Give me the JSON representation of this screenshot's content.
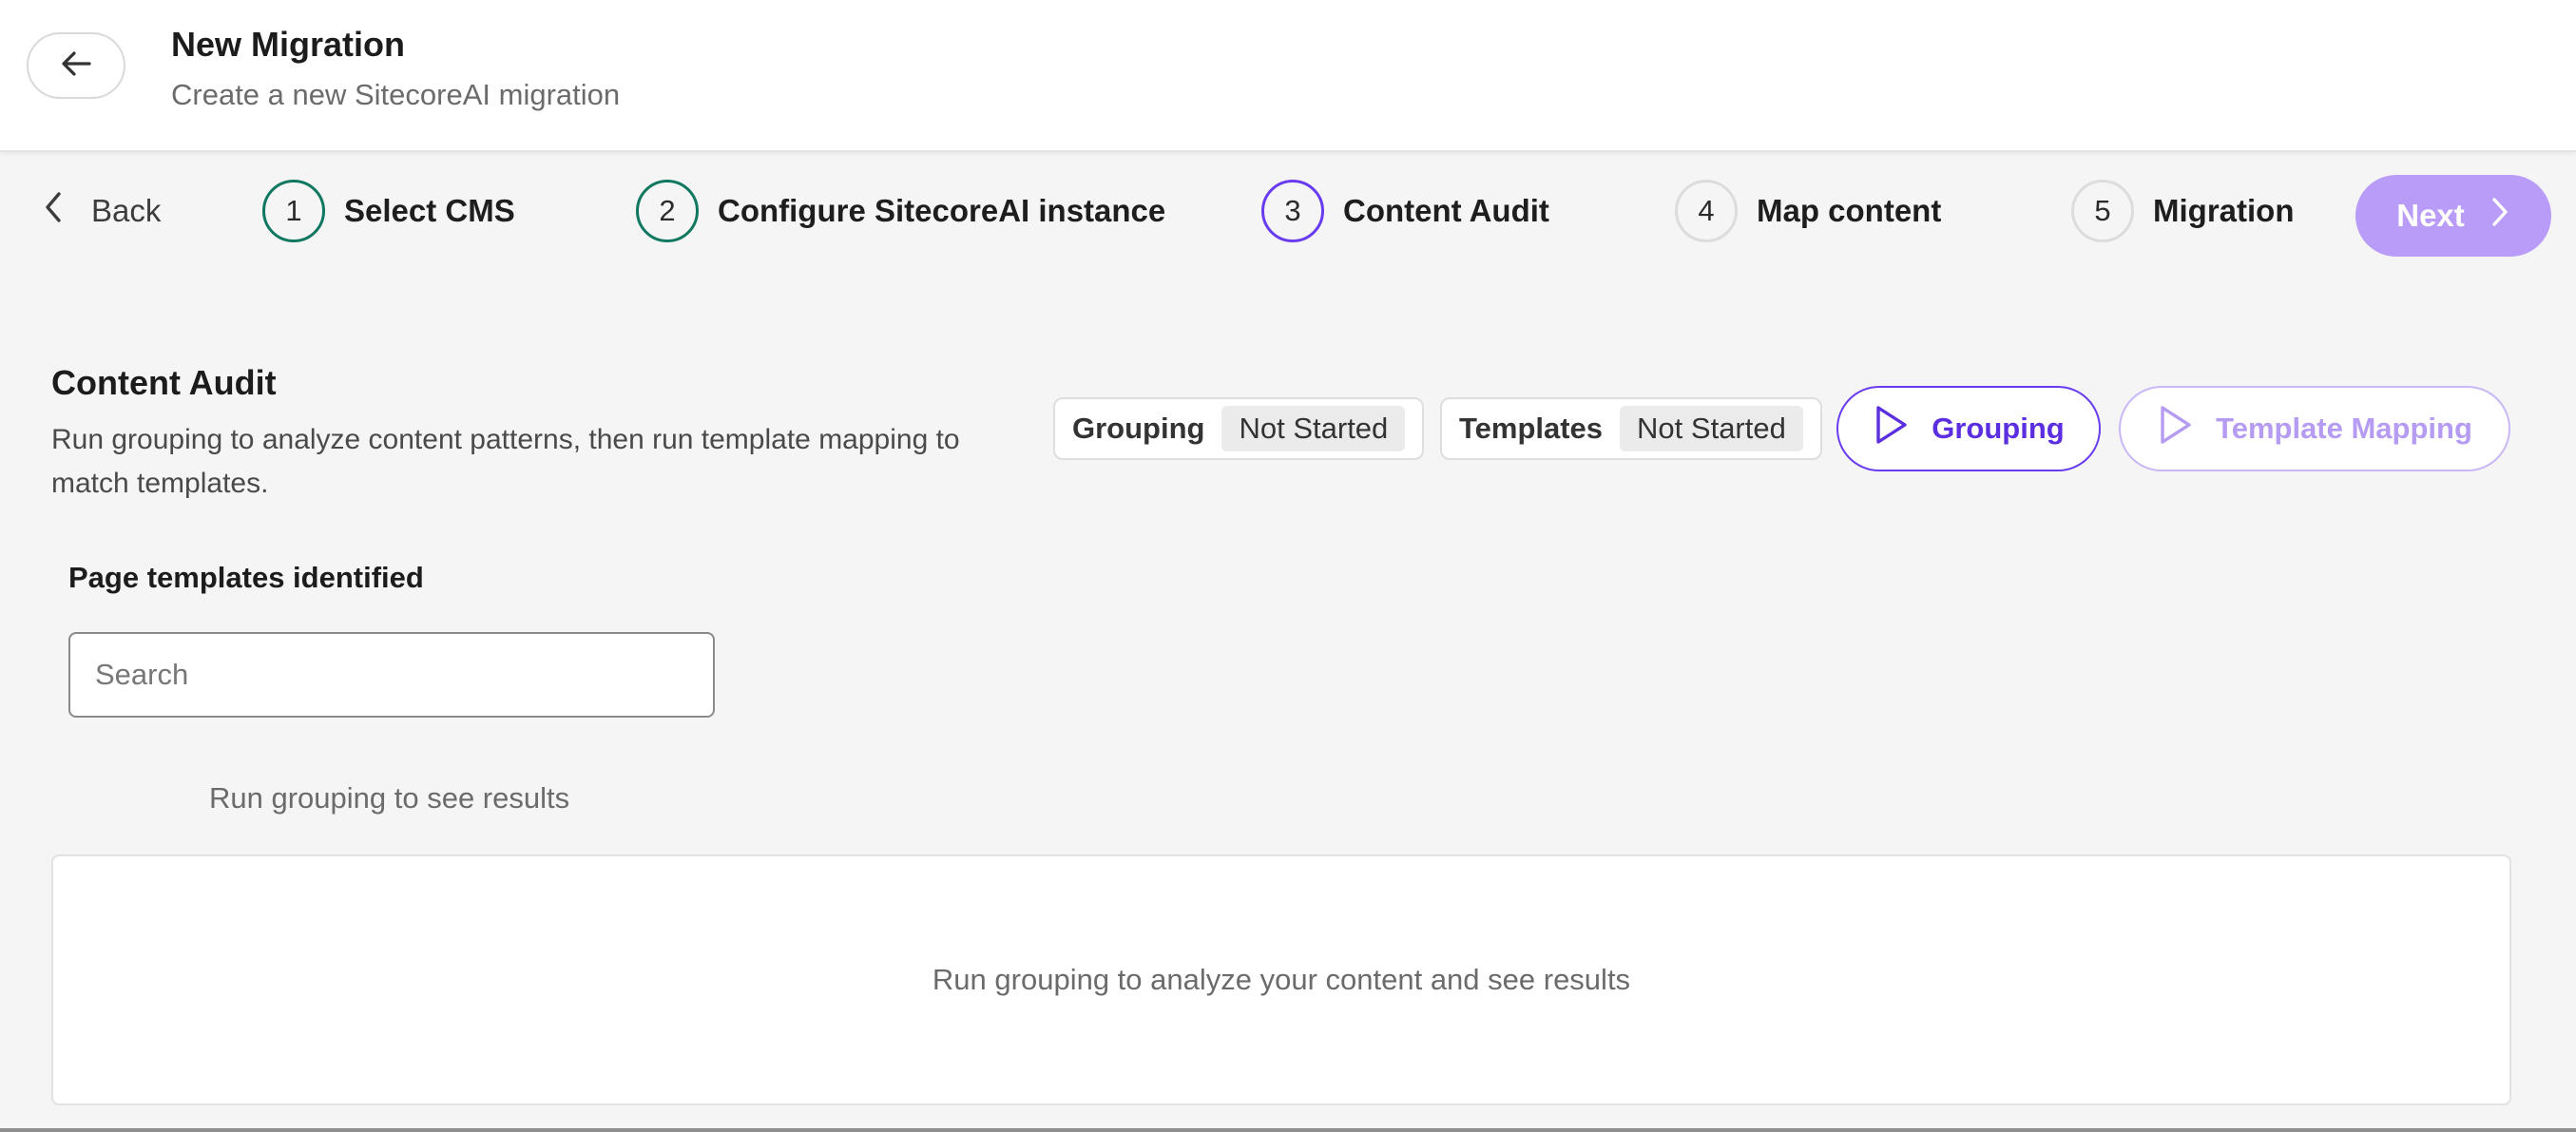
{
  "header": {
    "title": "New Migration",
    "subtitle": "Create a new SitecoreAI migration"
  },
  "stepper": {
    "back_label": "Back",
    "steps": [
      {
        "number": "1",
        "label": "Select CMS",
        "state": "done"
      },
      {
        "number": "2",
        "label": "Configure SitecoreAI instance",
        "state": "done"
      },
      {
        "number": "3",
        "label": "Content Audit",
        "state": "active"
      },
      {
        "number": "4",
        "label": "Map content",
        "state": "todo"
      },
      {
        "number": "5",
        "label": "Migration",
        "state": "todo"
      }
    ],
    "next_label": "Next"
  },
  "audit": {
    "title": "Content Audit",
    "description": "Run grouping to analyze content patterns, then run template mapping to match templates.",
    "statuses": [
      {
        "label": "Grouping",
        "value": "Not Started"
      },
      {
        "label": "Templates",
        "value": "Not Started"
      }
    ],
    "grouping_button": "Grouping",
    "template_mapping_button": "Template Mapping"
  },
  "templates": {
    "heading": "Page templates identified",
    "search_placeholder": "Search",
    "empty_hint": "Run grouping to see results",
    "results_empty_text": "Run grouping to analyze your content and see results"
  },
  "colors": {
    "accent": "#6a3cf0",
    "accent_disabled": "#b99cf7",
    "done": "#107861"
  },
  "icons": {
    "header_back": "arrow-left-icon",
    "step_back": "chevron-left-icon",
    "next": "chevron-right-icon",
    "run": "play-icon"
  }
}
